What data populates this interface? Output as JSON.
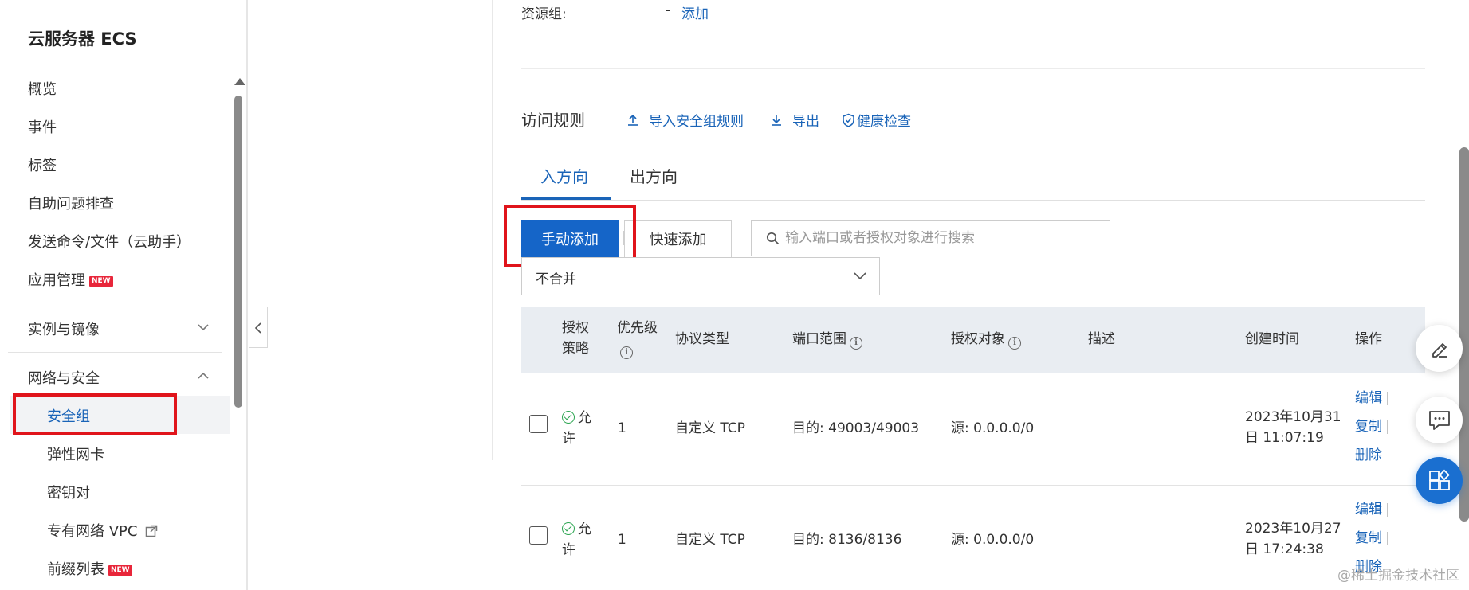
{
  "sidebar": {
    "title": "云服务器 ECS",
    "items": [
      {
        "label": "概览"
      },
      {
        "label": "事件"
      },
      {
        "label": "标签"
      },
      {
        "label": "自助问题排查"
      },
      {
        "label": "发送命令/文件（云助手）"
      },
      {
        "label": "应用管理",
        "badge": "NEW"
      }
    ],
    "groups": [
      {
        "label": "实例与镜像",
        "expanded": false
      },
      {
        "label": "网络与安全",
        "expanded": true
      }
    ],
    "sub_items": [
      {
        "label": "安全组",
        "active": true
      },
      {
        "label": "弹性网卡"
      },
      {
        "label": "密钥对"
      },
      {
        "label": "专有网络 VPC",
        "external": true
      },
      {
        "label": "前缀列表",
        "badge": "NEW"
      }
    ]
  },
  "resource_group": {
    "label": "资源组:",
    "value": "-",
    "add_link": "添加"
  },
  "access_rules": {
    "title": "访问规则",
    "import_label": "导入安全组规则",
    "export_label": "导出",
    "health_label": "健康检查"
  },
  "tabs": [
    {
      "label": "入方向",
      "active": true
    },
    {
      "label": "出方向",
      "active": false
    }
  ],
  "actions": {
    "manual_add": "手动添加",
    "quick_add": "快速添加",
    "search_placeholder": "输入端口或者授权对象进行搜索",
    "merge_select": "不合并"
  },
  "table": {
    "headers": {
      "policy_line1": "授权",
      "policy_line2": "策略",
      "priority": "优先级",
      "protocol": "协议类型",
      "port_range": "端口范围",
      "auth_object": "授权对象",
      "description": "描述",
      "created": "创建时间",
      "ops": "操作"
    },
    "rows": [
      {
        "policy_line1": "允",
        "policy_line2": "许",
        "priority": "1",
        "protocol": "自定义 TCP",
        "port_range": "目的: 49003/49003",
        "auth_object": "源: 0.0.0.0/0",
        "description": "",
        "created_line1": "2023年10月31",
        "created_line2": "日 11:07:19",
        "edit": "编辑",
        "copy": "复制",
        "delete": "删除"
      },
      {
        "policy_line1": "允",
        "policy_line2": "许",
        "priority": "1",
        "protocol": "自定义 TCP",
        "port_range": "目的: 8136/8136",
        "auth_object": "源: 0.0.0.0/0",
        "description": "",
        "created_line1": "2023年10月27",
        "created_line2": "日 17:24:38",
        "edit": "编辑",
        "copy": "复制",
        "delete": "删除"
      }
    ]
  },
  "watermark": "@稀土掘金技术社区",
  "colors": {
    "accent": "#1a64b8",
    "primary_button": "#1565c8",
    "highlight_box": "#e0141b",
    "badge_new": "#e8263a"
  }
}
